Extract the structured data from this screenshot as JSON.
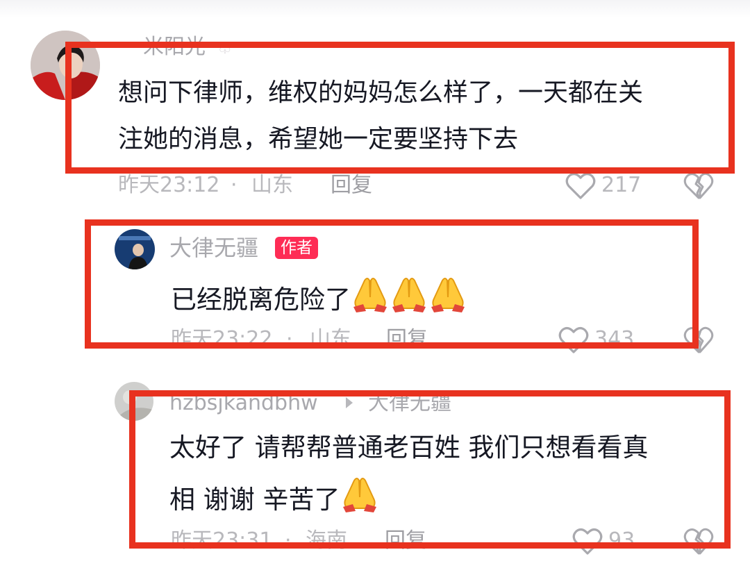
{
  "comments": [
    {
      "username": "米阳光",
      "text_lines": [
        "想问下律师，维权的妈妈怎么样了，一天都在关",
        "注她的消息，希望她一定要坚持下去"
      ],
      "time": "昨天23:12",
      "separator": "·",
      "location": "山东",
      "reply_label": "回复",
      "likes": "217"
    },
    {
      "username": "大律无疆",
      "badge": "作者",
      "text": "已经脱离危险了",
      "emoji_count": 3,
      "time": "昨天23:22",
      "separator": "·",
      "location": "山东",
      "reply_label": "回复",
      "likes": "343"
    },
    {
      "username": "hzbsjkandbhw",
      "reply_to": "大律无疆",
      "text_lines": [
        "太好了 请帮帮普通老百姓 我们只想看看真",
        "相 谢谢 辛苦了"
      ],
      "emoji_count": 1,
      "time": "昨天23:31",
      "separator": "·",
      "location": "海南",
      "reply_label": "回复",
      "likes": "93"
    }
  ],
  "colors": {
    "highlight_box": "#e8321f",
    "author_badge": "#fe2c55",
    "meta_gray": "#b8b8bc",
    "body_text": "#161823"
  },
  "icons": [
    "heart-outline-icon",
    "broken-heart-icon",
    "reply-arrow-icon",
    "folded-hands-emoji"
  ]
}
